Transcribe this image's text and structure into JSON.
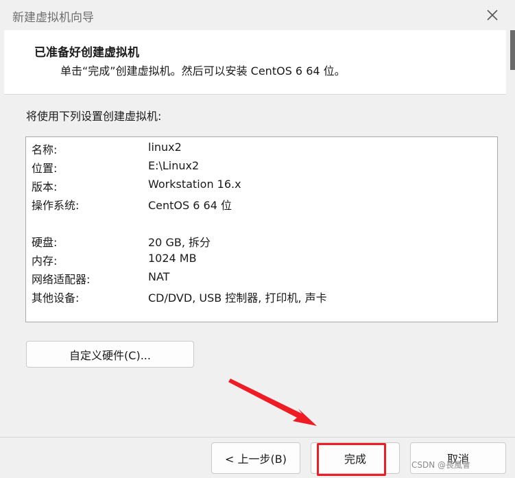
{
  "window": {
    "title": "新建虚拟机向导"
  },
  "header": {
    "title": "已准备好创建虚拟机",
    "subtitle": "单击“完成”创建虚拟机。然后可以安装 CentOS 6 64 位。"
  },
  "section_label": "将使用下列设置创建虚拟机:",
  "summary": [
    {
      "label": "名称:",
      "value": "linux2"
    },
    {
      "label": "位置:",
      "value": "E:\\Linux2"
    },
    {
      "label": "版本:",
      "value": "Workstation 16.x"
    },
    {
      "label": "操作系统:",
      "value": "CentOS 6 64 位"
    },
    {
      "label": "硬盘:",
      "value": "20 GB, 拆分"
    },
    {
      "label": "内存:",
      "value": "1024 MB"
    },
    {
      "label": "网络适配器:",
      "value": "NAT"
    },
    {
      "label": "其他设备:",
      "value": "CD/DVD, USB 控制器, 打印机, 声卡"
    }
  ],
  "buttons": {
    "custom_hardware": "自定义硬件(C)...",
    "back": "< 上一步(B)",
    "finish": "完成",
    "cancel": "取消"
  },
  "watermark": "CSDN @長風會",
  "colors": {
    "highlight": "#ee1c24",
    "arrow": "#ee1c24"
  },
  "icons": {
    "close": "close-icon"
  }
}
